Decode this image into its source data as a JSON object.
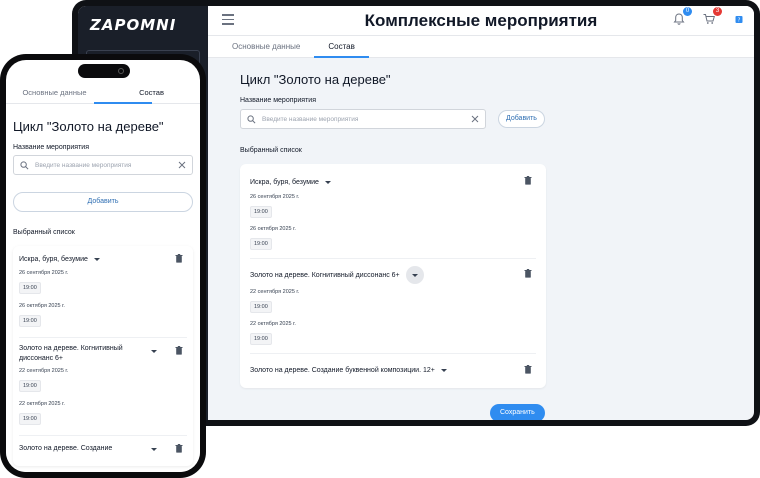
{
  "desktop": {
    "logo": "ZAPOMNI",
    "title": "Комплексные мероприятия",
    "badges": {
      "notifications": "0",
      "cart": "3"
    },
    "tabs": [
      "Основные данные",
      "Состав"
    ],
    "heading": "Цикл \"Золото на дереве\"",
    "name_label": "Название мероприятия",
    "search_placeholder": "Введите название мероприятия",
    "add_button": "Добавить",
    "selected_label": "Выбранный список",
    "events": [
      {
        "name": "Искра, буря, безумие",
        "sessions": [
          {
            "date": "26 сентября 2025 г.",
            "time": "19:00"
          },
          {
            "date": "26 октября 2025 г.",
            "time": "19:00"
          }
        ]
      },
      {
        "name": "Золото на дереве. Когнитивный диссонанс 6+",
        "sessions": [
          {
            "date": "22 сентября 2025 г.",
            "time": "19:00"
          },
          {
            "date": "22 октября 2025 г.",
            "time": "19:00"
          }
        ]
      },
      {
        "name": "Золото на дереве. Создание буквенной композиции. 12+"
      }
    ],
    "save_button": "Сохранить"
  },
  "mobile": {
    "tabs": [
      "Основные данные",
      "Состав"
    ],
    "heading": "Цикл \"Золото на дереве\"",
    "name_label": "Название мероприятия",
    "search_placeholder": "Введите название мероприятия",
    "add_button": "Добавить",
    "selected_label": "Выбранный список",
    "events": [
      {
        "name": "Искра, буря, безумие",
        "sessions": [
          {
            "date": "26 сентября 2025 г.",
            "time": "19:00"
          },
          {
            "date": "26 октября 2025 г.",
            "time": "19:00"
          }
        ]
      },
      {
        "name": "Золото на дереве. Когнитивный диссонанс 6+",
        "sessions": [
          {
            "date": "22 сентября 2025 г.",
            "time": "19:00"
          },
          {
            "date": "22 октября 2025 г.",
            "time": "19:00"
          }
        ]
      },
      {
        "name": "Золото на дереве. Создание"
      }
    ]
  },
  "colors": {
    "accent": "#2f8cf0",
    "sidebar": "#1a1f29",
    "page_bg": "#f1f4f8"
  }
}
